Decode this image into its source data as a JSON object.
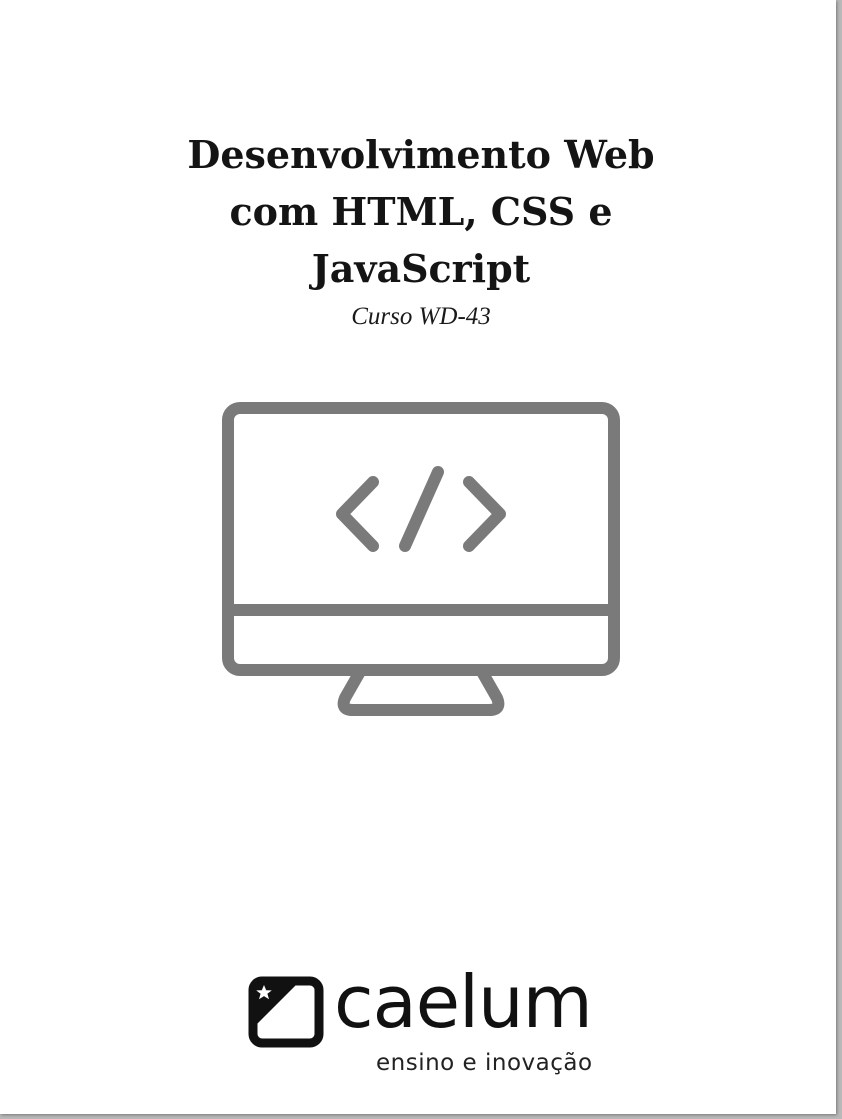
{
  "cover": {
    "title_lines": [
      "Desenvolvimento Web",
      "com HTML, CSS e",
      "JavaScript"
    ],
    "subtitle": "Curso WD-43"
  },
  "illustration": {
    "icon": "monitor-code-icon",
    "stroke_color": "#7a7a7a"
  },
  "logo": {
    "name": "caelum",
    "tagline": "ensino e inovação",
    "color": "#111111"
  }
}
